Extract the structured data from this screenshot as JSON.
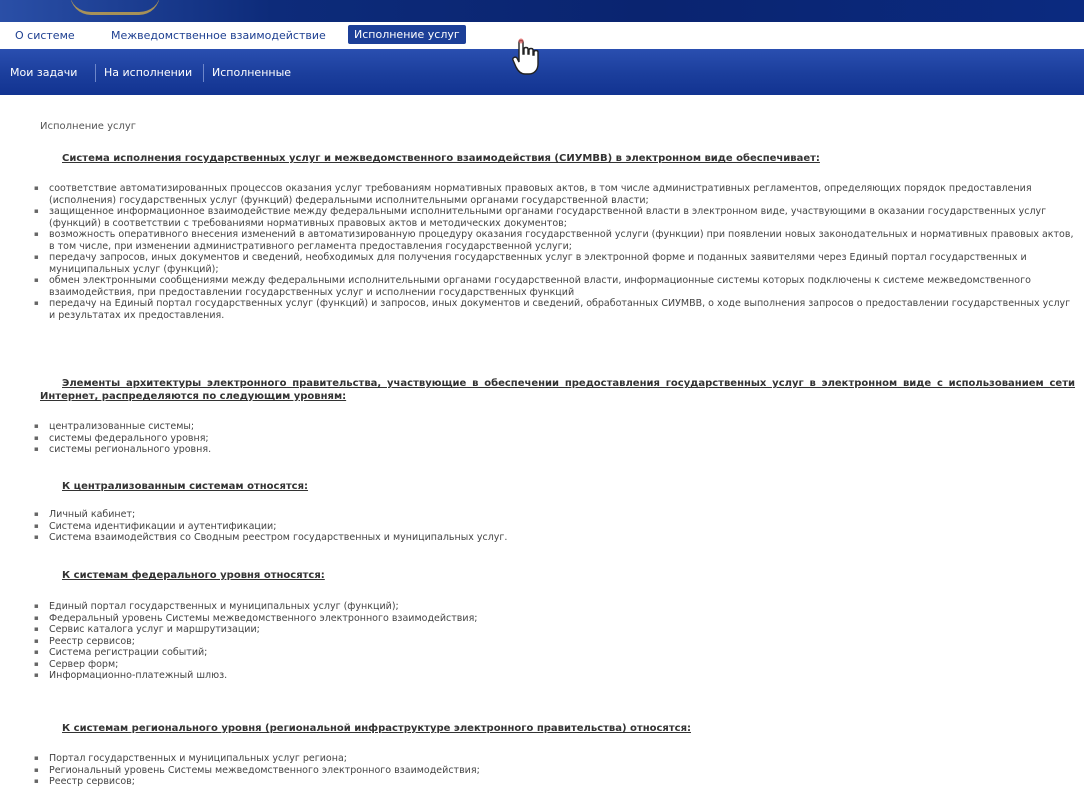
{
  "header": {
    "user_text": ""
  },
  "menu": {
    "items": [
      {
        "label": "О системе",
        "active": false
      },
      {
        "label": "Межведомственное взаимодействие",
        "active": false
      },
      {
        "label": "Исполнение услуг",
        "active": true
      }
    ]
  },
  "submenu": {
    "items": [
      "Мои задачи",
      "На исполнении",
      "Исполненные"
    ]
  },
  "breadcrumb": "Исполнение услуг",
  "section1": {
    "heading": "Система исполнения государственных услуг и межведомственного взаимодействия (СИУМВВ) в электронном виде обеспечивает:",
    "items": [
      "соответствие автоматизированных процессов оказания услуг требованиям нормативных правовых актов, в том числе административных регламентов, определяющих порядок предоставления (исполнения) государственных услуг (функций) федеральными исполнительными органами государственной власти;",
      "защищенное информационное взаимодействие между федеральными исполнительными органами государственной власти в электронном виде, участвующими в оказании государственных услуг (функций) в соответствии с требованиями нормативных правовых актов и методических документов;",
      "возможность оперативного внесения изменений в автоматизированную процедуру оказания государственной услуги (функции) при появлении новых законодательных и нормативных правовых актов, в том числе, при изменении административного регламента предоставления государственной услуги;",
      "передачу запросов, иных документов и сведений, необходимых для получения государственных услуг в электронной форме и поданных заявителями через Единый портал государственных и муниципальных услуг (функций);",
      "обмен электронными сообщениями между федеральными исполнительными органами государственной власти, информационные системы которых подключены к системе межведомственного взаимодействия, при предоставлении государственных услуг и исполнении государственных функций",
      "передачу на Единый портал государственных услуг (функций) и запросов, иных документов и сведений, обработанных СИУМВВ, о ходе выполнения запросов о предоставлении государственных услуг и результатах их предоставления."
    ]
  },
  "section2": {
    "heading": "Элементы архитектуры электронного правительства, участвующие в обеспечении предоставления государственных услуг в электронном виде с использованием сети Интернет, распределяются по следующим уровням:",
    "items": [
      "централизованные системы;",
      "системы федерального уровня;",
      "системы регионального уровня."
    ]
  },
  "section3": {
    "heading": "К централизованным системам относятся:",
    "items": [
      "Личный кабинет;",
      "Система идентификации и аутентификации;",
      "Система взаимодействия со Сводным реестром государственных и муниципальных услуг."
    ]
  },
  "section4": {
    "heading": "К системам федерального уровня относятся:",
    "items": [
      "Единый портал государственных и муниципальных услуг (функций);",
      "Федеральный уровень Системы межведомственного электронного взаимодействия;",
      "Сервис каталога услуг и маршрутизации;",
      "Реестр сервисов;",
      "Система регистрации событий;",
      "Сервер форм;",
      "Информационно-платежный шлюз."
    ]
  },
  "section5": {
    "heading": "К системам регионального уровня (региональной инфраструктуре электронного правительства) относятся:",
    "items": [
      "Портал государственных и муниципальных услуг региона;",
      "Региональный уровень Системы межведомственного электронного взаимодействия;",
      "Реестр сервисов;"
    ]
  },
  "colors": {
    "accent": "#1c3f98",
    "header_bg": "#0a2470"
  }
}
